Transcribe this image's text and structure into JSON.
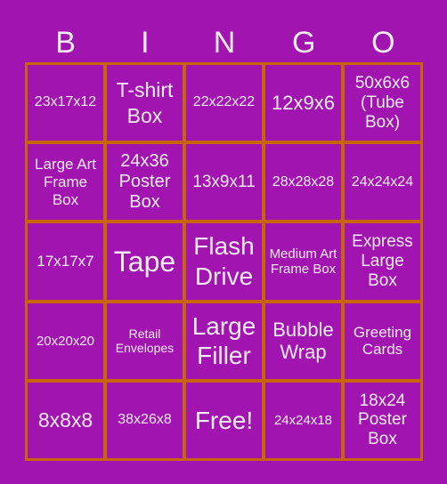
{
  "header": [
    "B",
    "I",
    "N",
    "G",
    "O"
  ],
  "cells": [
    [
      "23x17x12",
      "T-shirt Box",
      "22x22x22",
      "12x9x6",
      "50x6x6 (Tube Box)"
    ],
    [
      "Large Art Frame Box",
      "24x36 Poster Box",
      "13x9x11",
      "28x28x28",
      "24x24x24"
    ],
    [
      "17x17x7",
      "Tape",
      "Flash Drive",
      "Medium Art Frame Box",
      "Express Large Box"
    ],
    [
      "20x20x20",
      "Retail Envelopes",
      "Large Filler",
      "Bubble Wrap",
      "Greeting Cards"
    ],
    [
      "8x8x8",
      "38x26x8",
      "Free!",
      "24x24x18",
      "18x24 Poster Box"
    ]
  ],
  "colors": {
    "background": "#A214B0",
    "grid_border": "#C8640A",
    "text": "#F3ECF5"
  }
}
